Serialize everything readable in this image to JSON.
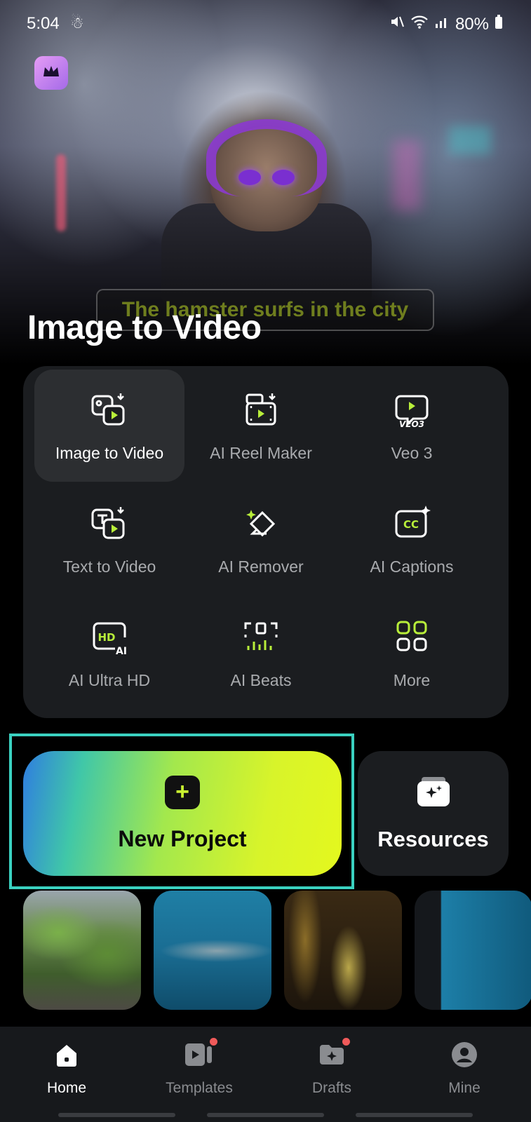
{
  "status_bar": {
    "time": "5:04",
    "battery": "80%",
    "icons": [
      "snowman-icon",
      "mute-icon",
      "wifi-icon",
      "signal-icon",
      "battery-icon"
    ]
  },
  "hero": {
    "caption": "The hamster surfs in the city",
    "title": "Image to Video",
    "premium_icon": "crown-icon"
  },
  "tools": [
    {
      "label": "Image to Video",
      "icon": "image-to-video-icon",
      "active": true
    },
    {
      "label": "AI Reel Maker",
      "icon": "reel-maker-icon",
      "active": false
    },
    {
      "label": "Veo 3",
      "icon": "veo3-icon",
      "active": false
    },
    {
      "label": "Text to Video",
      "icon": "text-to-video-icon",
      "active": false
    },
    {
      "label": "AI Remover",
      "icon": "eraser-icon",
      "active": false
    },
    {
      "label": "AI Captions",
      "icon": "captions-icon",
      "active": false
    },
    {
      "label": "AI Ultra HD",
      "icon": "hd-ai-icon",
      "active": false
    },
    {
      "label": "AI Beats",
      "icon": "beats-icon",
      "active": false
    },
    {
      "label": "More",
      "icon": "grid-icon",
      "active": false
    }
  ],
  "actions": {
    "new_project": "New Project",
    "resources": "Resources"
  },
  "recent_media": [
    "garden photo",
    "fish in aquarium",
    "performer on stage",
    "aquarium fish"
  ],
  "bottom_nav": [
    {
      "label": "Home",
      "icon": "home-icon",
      "active": true,
      "badge": false
    },
    {
      "label": "Templates",
      "icon": "templates-icon",
      "active": false,
      "badge": true
    },
    {
      "label": "Drafts",
      "icon": "drafts-icon",
      "active": false,
      "badge": true
    },
    {
      "label": "Mine",
      "icon": "profile-icon",
      "active": false,
      "badge": false
    }
  ],
  "colors": {
    "accent_green": "#c9f230",
    "highlight_outline": "#3ad1c0",
    "badge_red": "#f05a5a"
  }
}
